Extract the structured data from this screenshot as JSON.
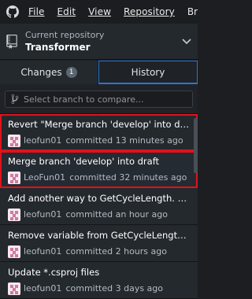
{
  "menu": {
    "items": [
      "File",
      "Edit",
      "View",
      "Repository"
    ],
    "more": "Br"
  },
  "repo": {
    "caption": "Current repository",
    "name": "Transformer"
  },
  "tabs": {
    "changes_label": "Changes",
    "changes_count": "1",
    "history_label": "History"
  },
  "filter": {
    "placeholder": "Select branch to compare..."
  },
  "commits": [
    {
      "title": "Revert \"Merge branch 'develop' into dr...",
      "author": "leofun01",
      "when": "committed 13 minutes ago"
    },
    {
      "title": "Merge branch 'develop' into draft",
      "author": "LeoFun01",
      "when": "committed 32 minutes ago"
    },
    {
      "title": "Add another way to GetCycleLength. Up...",
      "author": "leofun01",
      "when": "committed an hour ago"
    },
    {
      "title": "Remove variable from GetCycleLength. ...",
      "author": "leofun01",
      "when": "committed 2 hours ago"
    },
    {
      "title": "Update *.csproj files",
      "author": "leofun01",
      "when": "committed 3 days ago"
    }
  ],
  "colors": {
    "accent": "#2d73d6",
    "highlight": "#e0121b"
  }
}
